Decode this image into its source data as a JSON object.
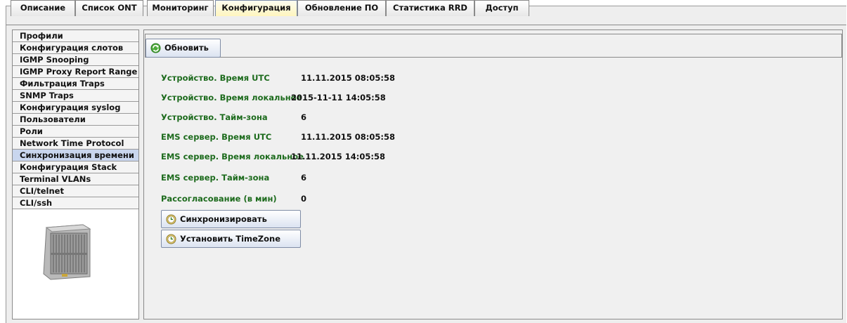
{
  "tabs": [
    "Описание",
    "Список ONT",
    "Мониторинг",
    "Конфигурация",
    "Обновление ПО",
    "Статистика RRD",
    "Доступ"
  ],
  "active_tab": "Конфигурация",
  "sidebar": {
    "items": [
      "Профили",
      "Конфигурация слотов",
      "IGMP Snooping",
      "IGMP Proxy Report Range",
      "Фильтрация Traps",
      "SNMP Traps",
      "Конфигурация syslog",
      "Пользователи",
      "Роли",
      "Network Time Protocol",
      "Синхронизация времени",
      "Конфигурация Stack",
      "Terminal VLANs",
      "CLI/telnet",
      "CLI/ssh"
    ],
    "active": "Синхронизация времени"
  },
  "toolbar": {
    "refresh_label": "Обновить"
  },
  "time": {
    "rows": [
      {
        "label": "Устройство. Время UTC",
        "value": "11.11.2015 08:05:58"
      },
      {
        "label": "Устройство. Время локальное",
        "value": "2015-11-11 14:05:58"
      },
      {
        "label": "Устройство. Тайм-зона",
        "value": "6"
      },
      {
        "label": "EMS сервер. Время UTC",
        "value": "11.11.2015 08:05:58"
      },
      {
        "label": "EMS сервер. Время локальное",
        "value": "11.11.2015 14:05:58"
      },
      {
        "label": "EMS сервер. Тайм-зона",
        "value": "6"
      },
      {
        "label": "Рассогласование (в мин)",
        "value": "0"
      }
    ]
  },
  "actions": {
    "sync_label": "Синхронизировать",
    "set_tz_label": "Установить TimeZone"
  },
  "colors": {
    "label_green": "#1d6b1d",
    "active_tab": "#fff5be",
    "active_item": "#c9d6ee"
  }
}
